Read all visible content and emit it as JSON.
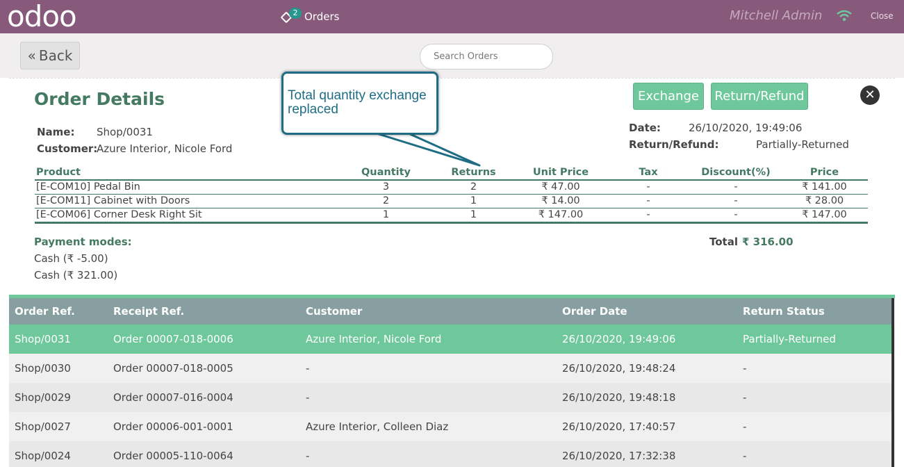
{
  "header": {
    "logo": "odoo",
    "orders_badge": "2",
    "orders_label": "Orders",
    "user": "Mitchell Admin",
    "close_label": "Close"
  },
  "controls": {
    "back_label": "Back",
    "search_placeholder": "Search Orders"
  },
  "details": {
    "title": "Order Details",
    "name_label": "Name:",
    "name_value": "Shop/0031",
    "customer_label": "Customer:",
    "customer_value": "Azure Interior, Nicole Ford",
    "date_label": "Date:",
    "date_value": "26/10/2020, 19:49:06",
    "status_label": "Return/Refund:",
    "status_value": "Partially-Returned",
    "exchange_label": "Exchange",
    "refund_label": "Return/Refund",
    "columns": [
      "Product",
      "Quantity",
      "Returns",
      "Unit Price",
      "Tax",
      "Discount(%)",
      "Price"
    ],
    "lines": [
      {
        "product": "[E-COM10] Pedal Bin",
        "qty": "3",
        "returns": "2",
        "unit": "₹ 47.00",
        "tax": "-",
        "disc": "-",
        "price": "₹ 141.00"
      },
      {
        "product": "[E-COM11] Cabinet with Doors",
        "qty": "2",
        "returns": "1",
        "unit": "₹ 14.00",
        "tax": "-",
        "disc": "-",
        "price": "₹ 28.00"
      },
      {
        "product": "[E-COM06] Corner Desk Right Sit",
        "qty": "1",
        "returns": "1",
        "unit": "₹ 147.00",
        "tax": "-",
        "disc": "-",
        "price": "₹ 147.00"
      }
    ],
    "payment_title": "Payment modes:",
    "payments": [
      "Cash (₹ -5.00)",
      "Cash (₹ 321.00)"
    ],
    "total_label": "Total",
    "total_value": "₹ 316.00"
  },
  "callout": {
    "text": "Total quantity exchange replaced"
  },
  "orders": {
    "columns": [
      "Order Ref.",
      "Receipt Ref.",
      "Customer",
      "Order Date",
      "Return Status"
    ],
    "rows": [
      {
        "ref": "Shop/0031",
        "receipt": "Order 00007-018-0006",
        "customer": "Azure Interior, Nicole Ford",
        "date": "26/10/2020, 19:49:06",
        "status": "Partially-Returned"
      },
      {
        "ref": "Shop/0030",
        "receipt": "Order 00007-018-0005",
        "customer": "-",
        "date": "26/10/2020, 19:48:24",
        "status": "-"
      },
      {
        "ref": "Shop/0029",
        "receipt": "Order 00007-016-0004",
        "customer": "-",
        "date": "26/10/2020, 19:48:18",
        "status": "-"
      },
      {
        "ref": "Shop/0027",
        "receipt": "Order 00006-001-0001",
        "customer": "Azure Interior, Colleen Diaz",
        "date": "26/10/2020, 17:40:57",
        "status": "-"
      },
      {
        "ref": "Shop/0024",
        "receipt": "Order 00005-110-0064",
        "customer": "-",
        "date": "26/10/2020, 17:32:38",
        "status": "-"
      }
    ]
  },
  "colors": {
    "topbar": "#875a7b",
    "accent_green": "#6ec89b",
    "heading_green": "#447a63",
    "callout_blue": "#1e6d85",
    "list_header": "#879fa0"
  }
}
